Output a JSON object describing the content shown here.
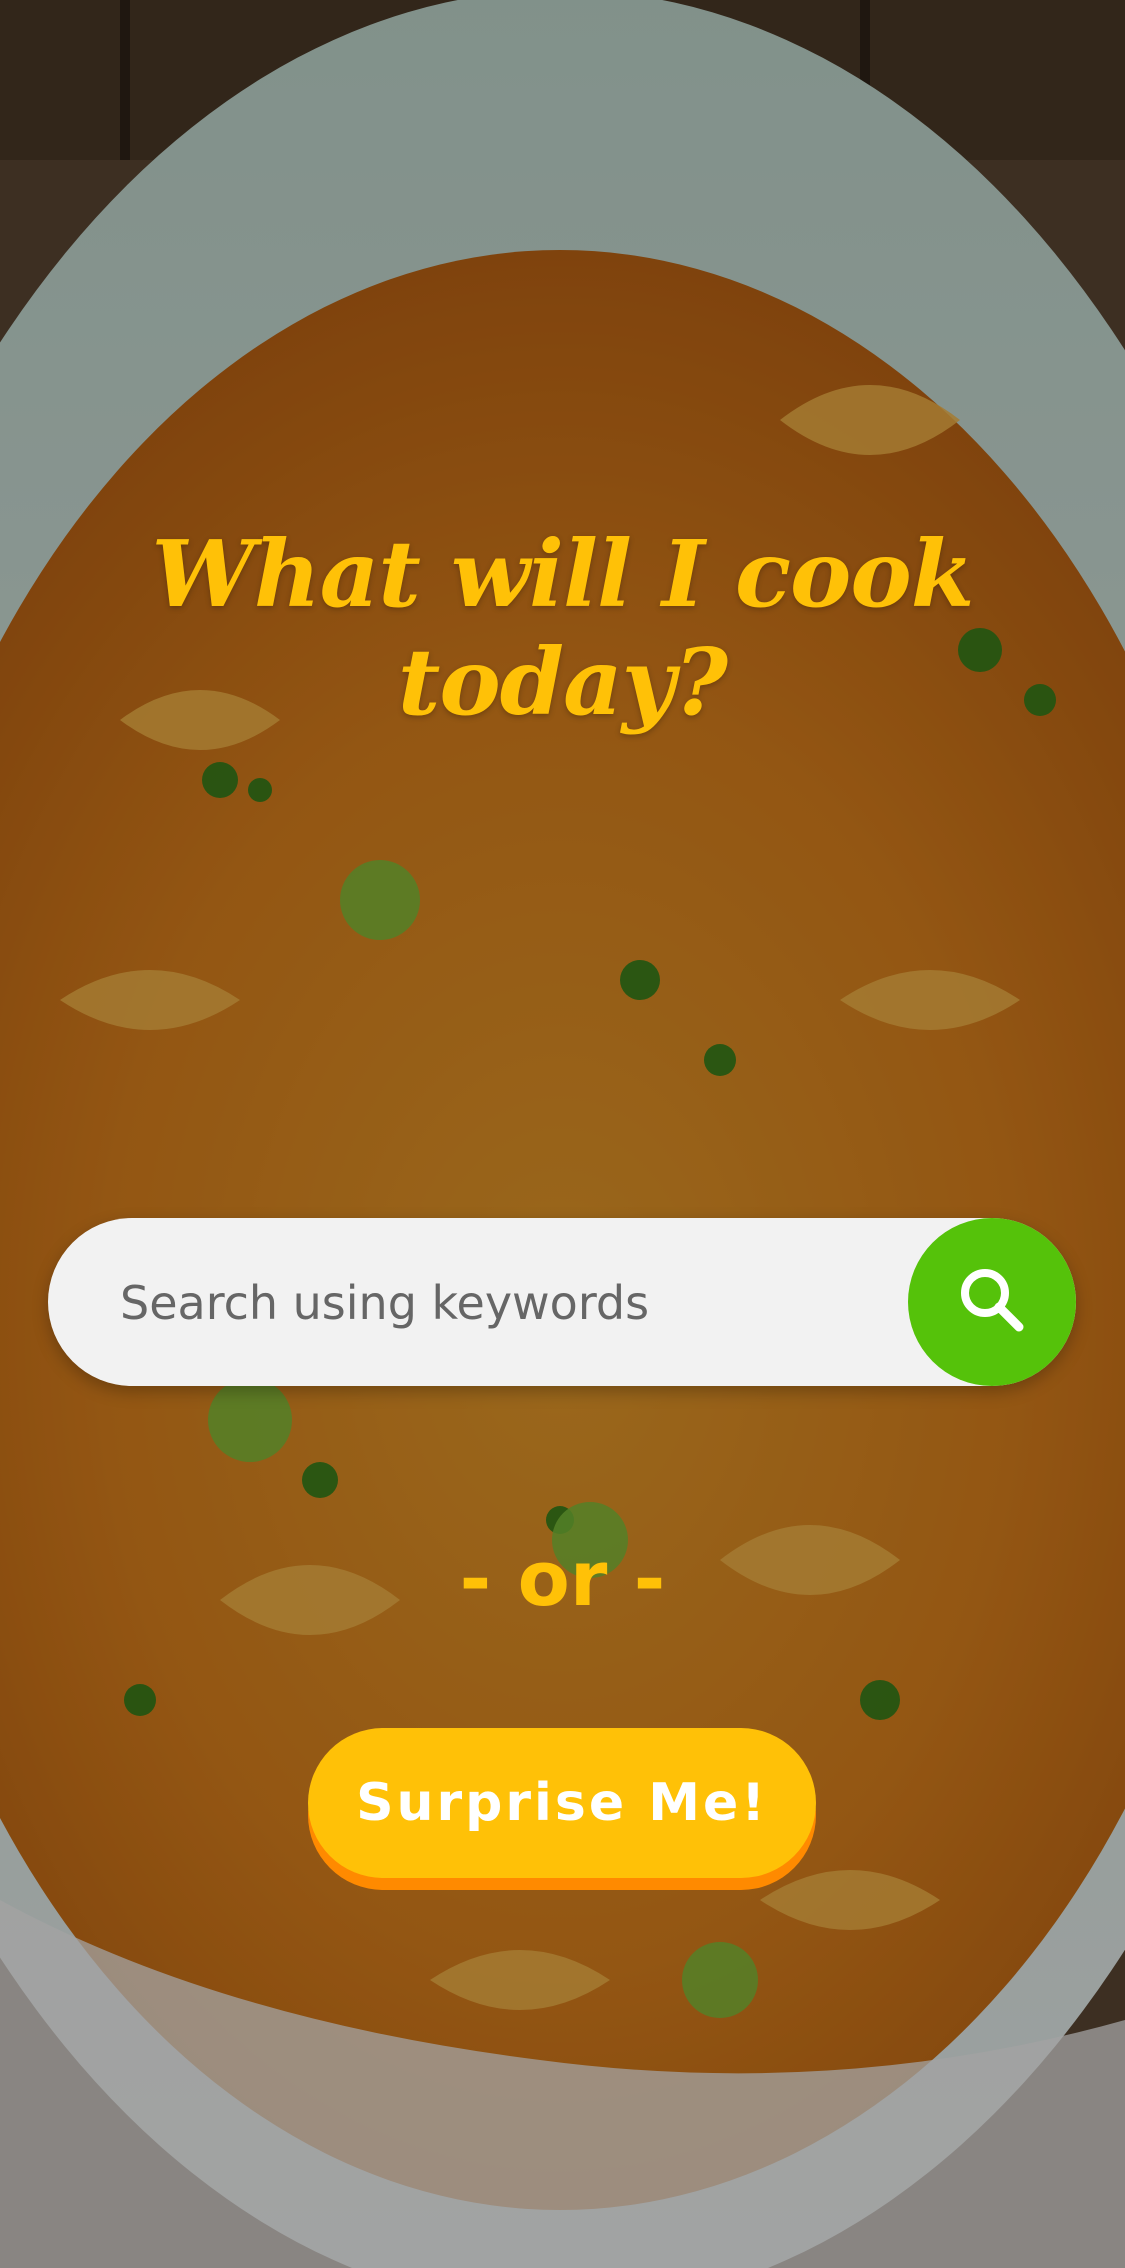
{
  "hero": {
    "title": "What will I cook today?"
  },
  "search": {
    "placeholder": "Search using keywords",
    "value": "",
    "icon": "search-icon"
  },
  "divider": {
    "text": "- or -"
  },
  "surprise": {
    "label": "Surprise Me!"
  },
  "colors": {
    "accent_yellow": "#ffc107",
    "accent_orange": "#ff8a00",
    "search_green": "#55c20a",
    "search_bg": "#f2f2f2"
  }
}
